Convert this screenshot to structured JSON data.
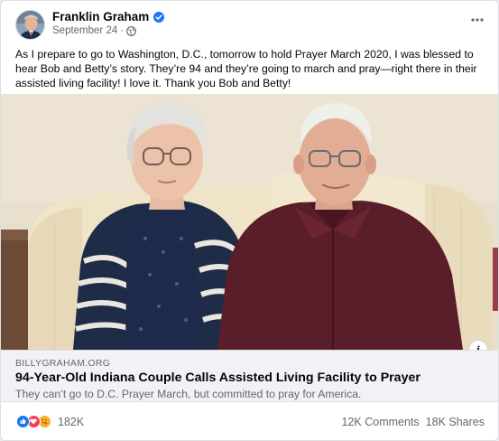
{
  "post": {
    "author": "Franklin Graham",
    "date": "September 24",
    "separator": "·",
    "text": "As I prepare to go to Washington, D.C., tomorrow to hold Prayer March 2020, I was blessed to hear Bob and Betty’s story. They’re 94 and they’re going to march and pray—right there in their assisted living facility! I love it. Thank you Bob and Betty!",
    "more_icon": "more-horizontal-icon",
    "verified_icon": "verified-badge-icon",
    "audience_icon": "globe-icon"
  },
  "link": {
    "domain": "BILLYGRAHAM.ORG",
    "title": "94-Year-Old Indiana Couple Calls Assisted Living Facility to Prayer",
    "description": "They can’t go to D.C. Prayer March, but committed to pray for America.",
    "info_icon": "info-icon",
    "info_glyph": "i"
  },
  "footer": {
    "reactions": [
      "like-reaction-icon",
      "love-reaction-icon",
      "care-reaction-icon"
    ],
    "reaction_count": "182K",
    "comments": "12K Comments",
    "shares": "18K Shares"
  },
  "colors": {
    "like": "#1877f2",
    "love": "#f33e58",
    "care": "#f7b125",
    "verified": "#1877f2",
    "secondary_text": "#65676b",
    "caption_bg": "#f0f2f5"
  }
}
